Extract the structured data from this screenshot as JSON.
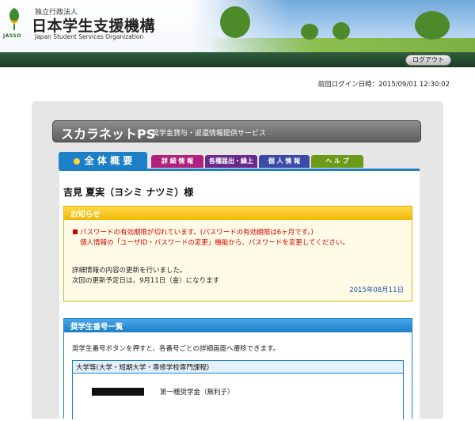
{
  "header": {
    "org_type": "独立行政法人",
    "org_name": "日本学生支援機構",
    "logo_text": "JASSO",
    "org_name_en": "Japan Student Services Organization",
    "logout_label": "ログアウト"
  },
  "last_login": "前回ログイン日時：2015/09/01 12:30:02",
  "service": {
    "title": "スカラネットPS",
    "subtitle": "奨学金貸与・返還情報提供サービス"
  },
  "tabs": [
    {
      "label": "全 体 概 要",
      "color": "#1d7fc7",
      "active": true
    },
    {
      "label": "詳 細 情 報",
      "color": "#b0217d",
      "active": false
    },
    {
      "label": "各種届出・繰上",
      "color": "#6a2a8a",
      "active": false
    },
    {
      "label": "個 人 情 報",
      "color": "#3c4aa8",
      "active": false
    },
    {
      "label": "ヘ ル プ",
      "color": "#6c9a1a",
      "active": false
    }
  ],
  "user": {
    "name": "吉見 夏実（ヨシミ ナツミ）様"
  },
  "notice": {
    "heading": "お知らせ",
    "password_line1": "パスワードの有効期限が切れています。(パスワードの有効期限は6ヶ月です。)",
    "password_line2": "個人情報の「ユーザID・パスワードの変更」機能から、パスワードを変更してください。",
    "update_line1": "詳細情報の内容の更新を行いました。",
    "update_line2": "次回の更新予定日は、9月11日（金）になります",
    "date": "2015年08月11日"
  },
  "scholarship_numbers": {
    "heading": "奨学生番号一覧",
    "description": "奨学生番号ボタンを押すと、各番号ごとの詳細画面へ遷移できます。",
    "category": "大学等(大学・短期大学・専修学校専門課程)",
    "scholarship_name": "第一種奨学金（無利子）"
  },
  "colors": {
    "accent_blue": "#1d7fc7",
    "header_green": "#1c3a25",
    "notice_yellow": "#f0b800",
    "warning_red": "#d40000"
  }
}
